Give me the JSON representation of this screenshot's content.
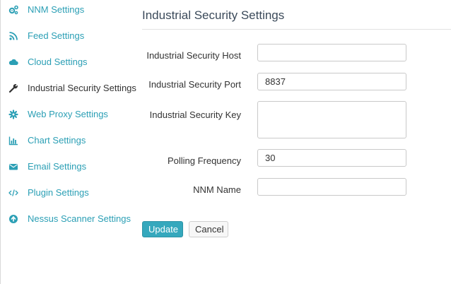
{
  "sidebar": {
    "items": [
      {
        "label": "NNM Settings",
        "icon": "gears-icon"
      },
      {
        "label": "Feed Settings",
        "icon": "rss-icon"
      },
      {
        "label": "Cloud Settings",
        "icon": "cloud-icon"
      },
      {
        "label": "Industrial Security Settings",
        "icon": "wrench-icon"
      },
      {
        "label": "Web Proxy Settings",
        "icon": "gear-icon"
      },
      {
        "label": "Chart Settings",
        "icon": "bar-chart-icon"
      },
      {
        "label": "Email Settings",
        "icon": "envelope-icon"
      },
      {
        "label": "Plugin Settings",
        "icon": "code-icon"
      },
      {
        "label": "Nessus Scanner Settings",
        "icon": "arrow-circle-up-icon"
      }
    ],
    "active_index": 3
  },
  "main": {
    "title": "Industrial Security Settings",
    "fields": {
      "host": {
        "label": "Industrial Security Host",
        "value": ""
      },
      "port": {
        "label": "Industrial Security Port",
        "value": "8837"
      },
      "key": {
        "label": "Industrial Security Key",
        "value": ""
      },
      "polling": {
        "label": "Polling Frequency",
        "value": "30"
      },
      "nnm_name": {
        "label": "NNM Name",
        "value": ""
      }
    },
    "buttons": {
      "update": "Update",
      "cancel": "Cancel"
    }
  },
  "colors": {
    "link": "#2b9fb5",
    "primary_button": "#35a8bd",
    "title": "#3b4a5a"
  }
}
